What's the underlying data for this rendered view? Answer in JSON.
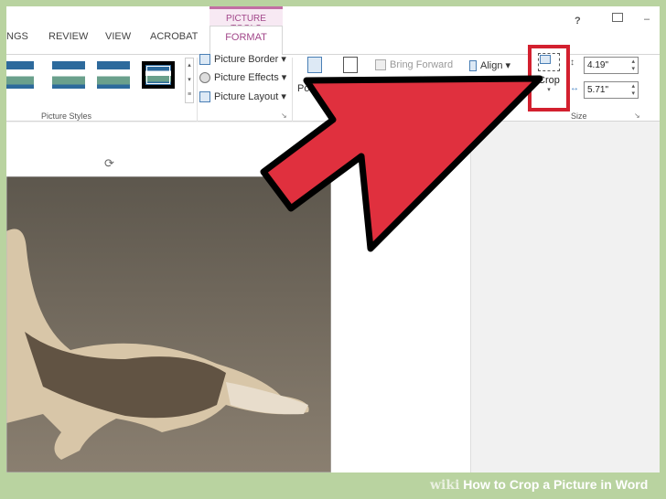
{
  "ribbon": {
    "tabs": [
      "NGS",
      "REVIEW",
      "VIEW",
      "ACROBAT"
    ],
    "context_label": "PICTURE TOOLS",
    "active_tab": "FORMAT",
    "window_controls": {
      "help": "?",
      "minimize": "–"
    },
    "picture_styles": {
      "group_label": "Picture Styles",
      "styles_count": 4,
      "selected_index": 3
    },
    "commands": {
      "border": "Picture Border ▾",
      "effects": "Picture Effects ▾",
      "layout": "Picture Layout ▾",
      "position": "Po",
      "bring_forward": "Bring Forward",
      "align": "Align ▾"
    },
    "crop": {
      "label": "Crop",
      "highlight_color": "#d3202f"
    },
    "size": {
      "group_label": "Size",
      "height": "4.19\"",
      "width": "5.71\""
    }
  },
  "annotation": {
    "arrow_color": "#e0303e",
    "target": "crop-button"
  },
  "watermark": {
    "brand": "wiki",
    "title": "How to Crop a Picture in Word"
  }
}
